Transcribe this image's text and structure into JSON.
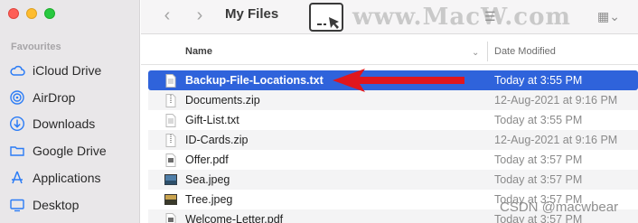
{
  "window": {
    "title": "My Files"
  },
  "toolbar": {
    "back_icon": "chevron-left",
    "forward_icon": "chevron-right",
    "watermark": "www.MacW.com"
  },
  "sidebar": {
    "heading": "Favourites",
    "items": [
      {
        "label": "iCloud Drive",
        "icon": "cloud-icon"
      },
      {
        "label": "AirDrop",
        "icon": "airdrop-icon"
      },
      {
        "label": "Downloads",
        "icon": "download-icon"
      },
      {
        "label": "Google Drive",
        "icon": "folder-icon"
      },
      {
        "label": "Applications",
        "icon": "applications-icon"
      },
      {
        "label": "Desktop",
        "icon": "desktop-icon"
      }
    ]
  },
  "columns": {
    "name": "Name",
    "date": "Date Modified"
  },
  "files": [
    {
      "name": "Backup-File-Locations.txt",
      "date": "Today at 3:55 PM",
      "type": "txt",
      "selected": true
    },
    {
      "name": "Documents.zip",
      "date": "12-Aug-2021 at 9:16 PM",
      "type": "zip",
      "selected": false
    },
    {
      "name": "Gift-List.txt",
      "date": "Today at 3:55 PM",
      "type": "txt",
      "selected": false
    },
    {
      "name": "ID-Cards.zip",
      "date": "12-Aug-2021 at 9:16 PM",
      "type": "zip",
      "selected": false
    },
    {
      "name": "Offer.pdf",
      "date": "Today at 3:57 PM",
      "type": "pdf",
      "selected": false
    },
    {
      "name": "Sea.jpeg",
      "date": "Today at 3:57 PM",
      "type": "jpeg",
      "selected": false
    },
    {
      "name": "Tree.jpeg",
      "date": "Today at 3:57 PM",
      "type": "jpeg",
      "selected": false
    },
    {
      "name": "Welcome-Letter.pdf",
      "date": "Today at 3:57 PM",
      "type": "pdf",
      "selected": false
    }
  ],
  "footer_watermark": "CSDN @macwbear",
  "colors": {
    "selection": "#2f63db",
    "arrow": "#e0161d",
    "sidebar_icon": "#2b7cf6"
  }
}
